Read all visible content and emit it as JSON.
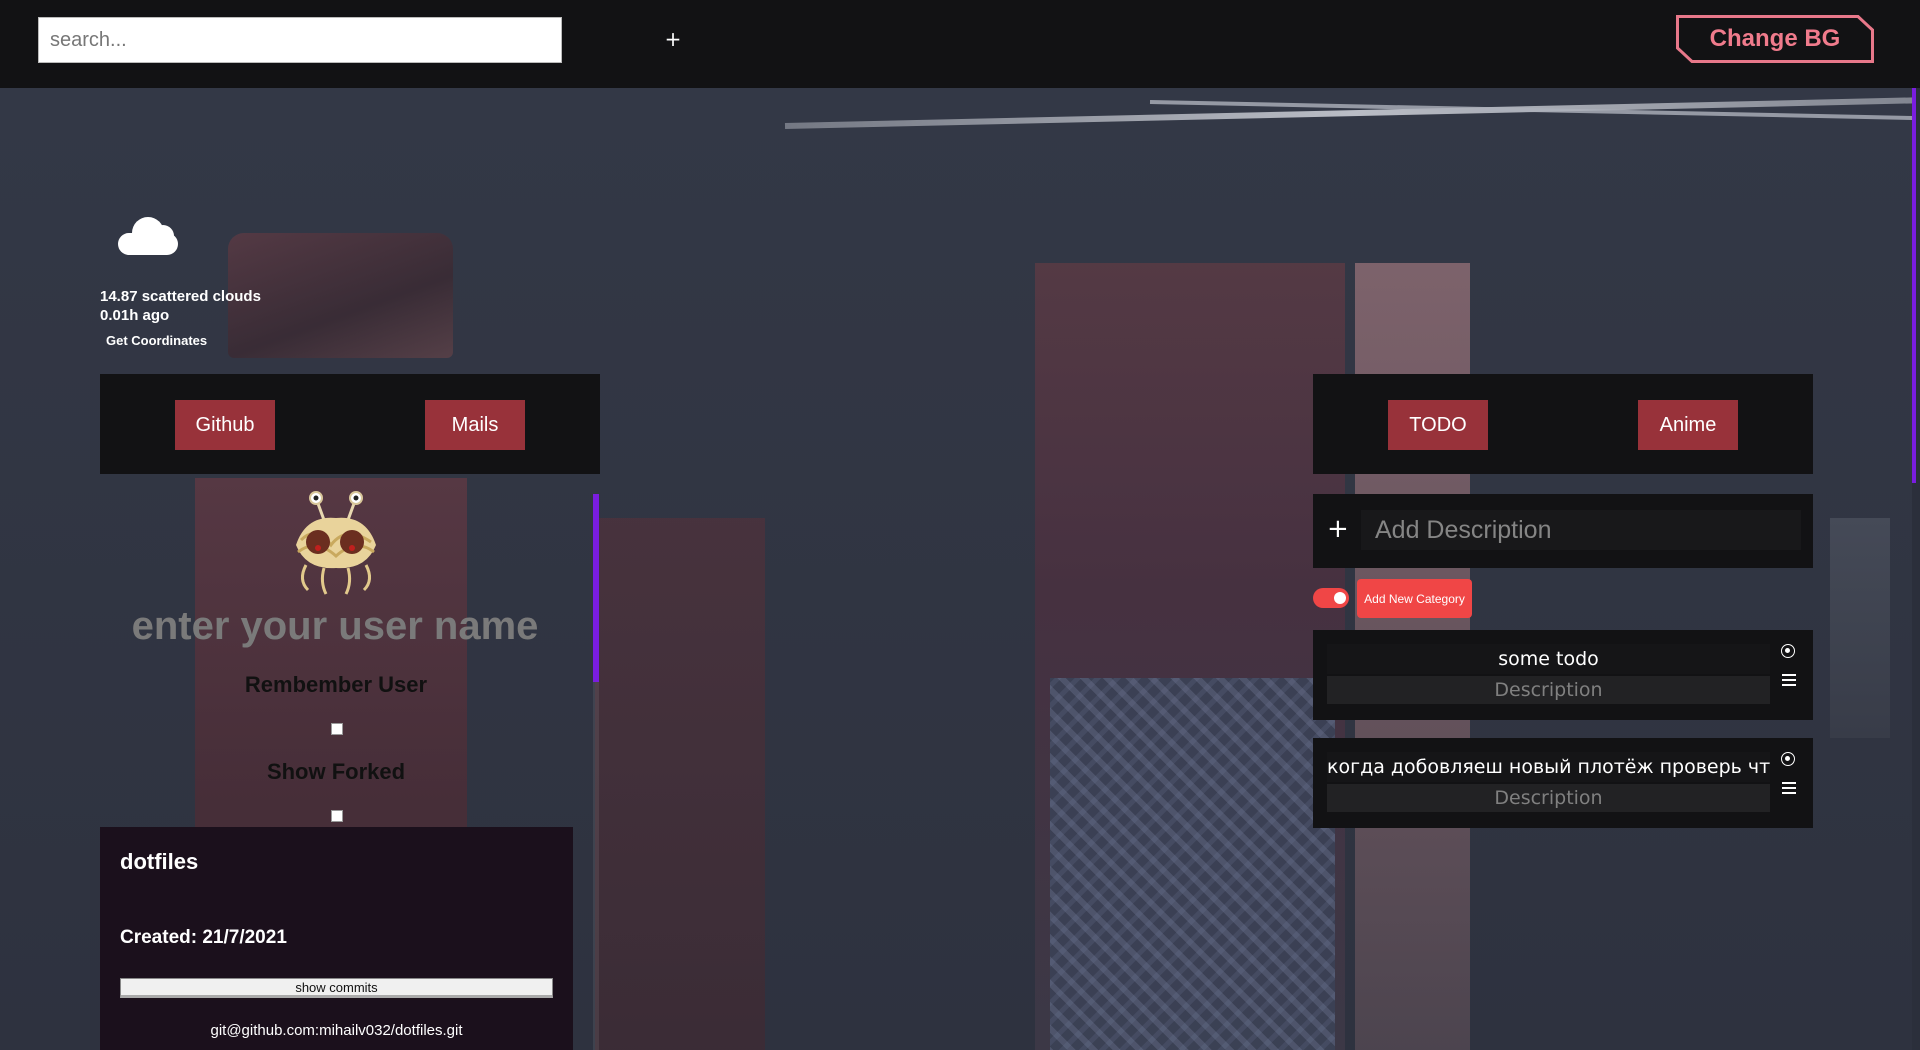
{
  "topbar": {
    "search_placeholder": "search...",
    "add_label": "+",
    "change_bg_label": "Change BG"
  },
  "weather": {
    "icon": "cloud-icon",
    "temp_desc": "14.87 scattered clouds",
    "updated": "0.01h ago",
    "get_coords_label": "Get Coordinates"
  },
  "left_nav": {
    "github_label": "Github",
    "mails_label": "Mails"
  },
  "right_nav": {
    "todo_label": "TODO",
    "anime_label": "Anime"
  },
  "github": {
    "username_placeholder": "enter your user name",
    "remember_label": "Rembember User",
    "show_forked_label": "Show Forked",
    "repo": {
      "name": "dotfiles",
      "created": "Created: 21/7/2021",
      "show_commits_label": "show commits",
      "ssh": "git@github.com:mihailv032/dotfiles.git"
    }
  },
  "todo": {
    "add_plus": "+",
    "add_placeholder": "Add Description",
    "add_category_label": "Add New Category",
    "items": [
      {
        "title": "some todo",
        "desc_placeholder": "Description"
      },
      {
        "title": "когда добовляеш новый плотёж проверь чт",
        "desc_placeholder": "Description"
      }
    ]
  },
  "colors": {
    "accent_red": "#98323a",
    "toggle_red": "#f04646",
    "change_bg_pink": "#f07b8c",
    "scroll_purple": "#7a1de0"
  }
}
